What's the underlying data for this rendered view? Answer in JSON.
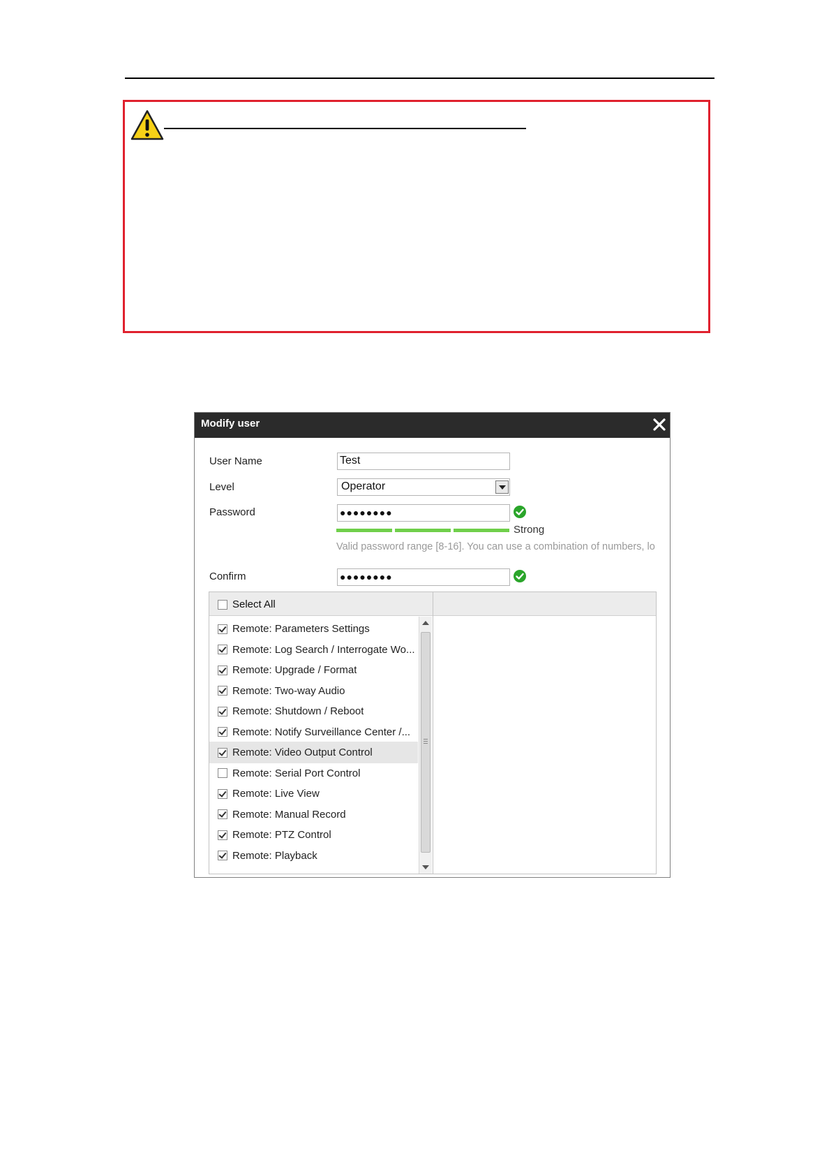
{
  "dialog": {
    "title": "Modify user"
  },
  "form": {
    "username_label": "User Name",
    "username_value": "Test",
    "level_label": "Level",
    "level_value": "Operator",
    "password_label": "Password",
    "password_value": "●●●●●●●●",
    "strength_label": "Strong",
    "hint": "Valid password range [8-16]. You can use a combination of numbers, lo",
    "confirm_label": "Confirm",
    "confirm_value": "●●●●●●●●"
  },
  "permissions": {
    "select_all_label": "Select All",
    "select_all_checked": false,
    "items": [
      {
        "label": "Remote: Parameters Settings",
        "checked": true
      },
      {
        "label": "Remote: Log Search / Interrogate Wo...",
        "checked": true
      },
      {
        "label": "Remote: Upgrade / Format",
        "checked": true
      },
      {
        "label": "Remote: Two-way Audio",
        "checked": true
      },
      {
        "label": "Remote: Shutdown / Reboot",
        "checked": true
      },
      {
        "label": "Remote: Notify Surveillance Center /...",
        "checked": true
      },
      {
        "label": "Remote: Video Output Control",
        "checked": true,
        "highlighted": true
      },
      {
        "label": "Remote: Serial Port Control",
        "checked": false
      },
      {
        "label": "Remote: Live View",
        "checked": true
      },
      {
        "label": "Remote: Manual Record",
        "checked": true
      },
      {
        "label": "Remote: PTZ Control",
        "checked": true
      },
      {
        "label": "Remote: Playback",
        "checked": true
      }
    ]
  },
  "colors": {
    "warning_border": "#e0212e",
    "header_bg": "#2b2b2b",
    "strength_green": "#6fcf4a",
    "ok_green": "#2aa52a"
  },
  "icons": {
    "warning": "warning-triangle-icon",
    "close": "close-icon",
    "ok": "check-circle-icon"
  }
}
